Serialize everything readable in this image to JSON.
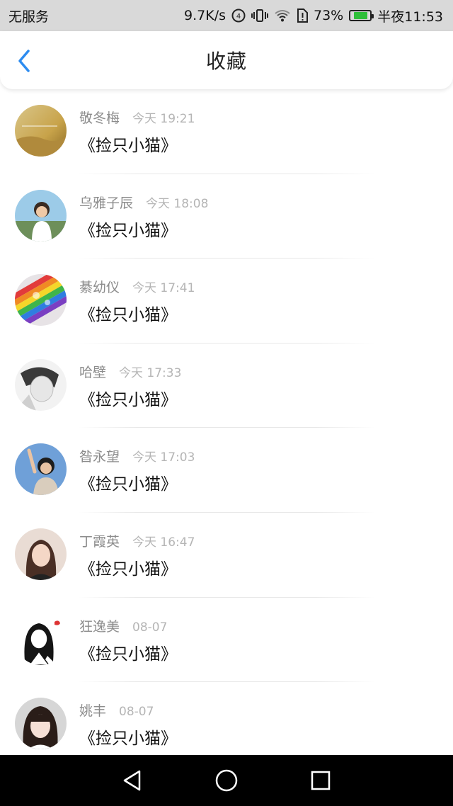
{
  "status_bar": {
    "carrier": "无服务",
    "speed": "9.7K/s",
    "battery": "73%",
    "battery_level": 0.73,
    "time": "半夜11:53",
    "icons": [
      "hd-icon",
      "vibrate-icon",
      "wifi-icon",
      "sim-alert-icon",
      "battery-icon"
    ]
  },
  "header": {
    "title": "收藏",
    "back_icon": "chevron-left-icon",
    "accent": "#2d8cf0"
  },
  "items": [
    {
      "name": "敬冬梅",
      "time": "今天 19:21",
      "title": "《捡只小猫》",
      "avatar": "golden-field"
    },
    {
      "name": "乌雅子辰",
      "time": "今天 18:08",
      "title": "《捡只小猫》",
      "avatar": "boy-outdoor"
    },
    {
      "name": "綦幼仪",
      "time": "今天 17:41",
      "title": "《捡只小猫》",
      "avatar": "rainbow-drops"
    },
    {
      "name": "哈壁",
      "time": "今天 17:33",
      "title": "《捡只小猫》",
      "avatar": "bw-portrait"
    },
    {
      "name": "昝永望",
      "time": "今天 17:03",
      "title": "《捡只小猫》",
      "avatar": "girl-blue-sky"
    },
    {
      "name": "丁霞英",
      "time": "今天 16:47",
      "title": "《捡只小猫》",
      "avatar": "girl-portrait"
    },
    {
      "name": "狂逸美",
      "time": "08-07",
      "title": "《捡只小猫》",
      "avatar": "anime-sketch"
    },
    {
      "name": "姚丰",
      "time": "08-07",
      "title": "《捡只小猫》",
      "avatar": "girl-bangs"
    }
  ],
  "nav_bar": {
    "icons": [
      "back-triangle-icon",
      "home-circle-icon",
      "recents-square-icon"
    ]
  }
}
